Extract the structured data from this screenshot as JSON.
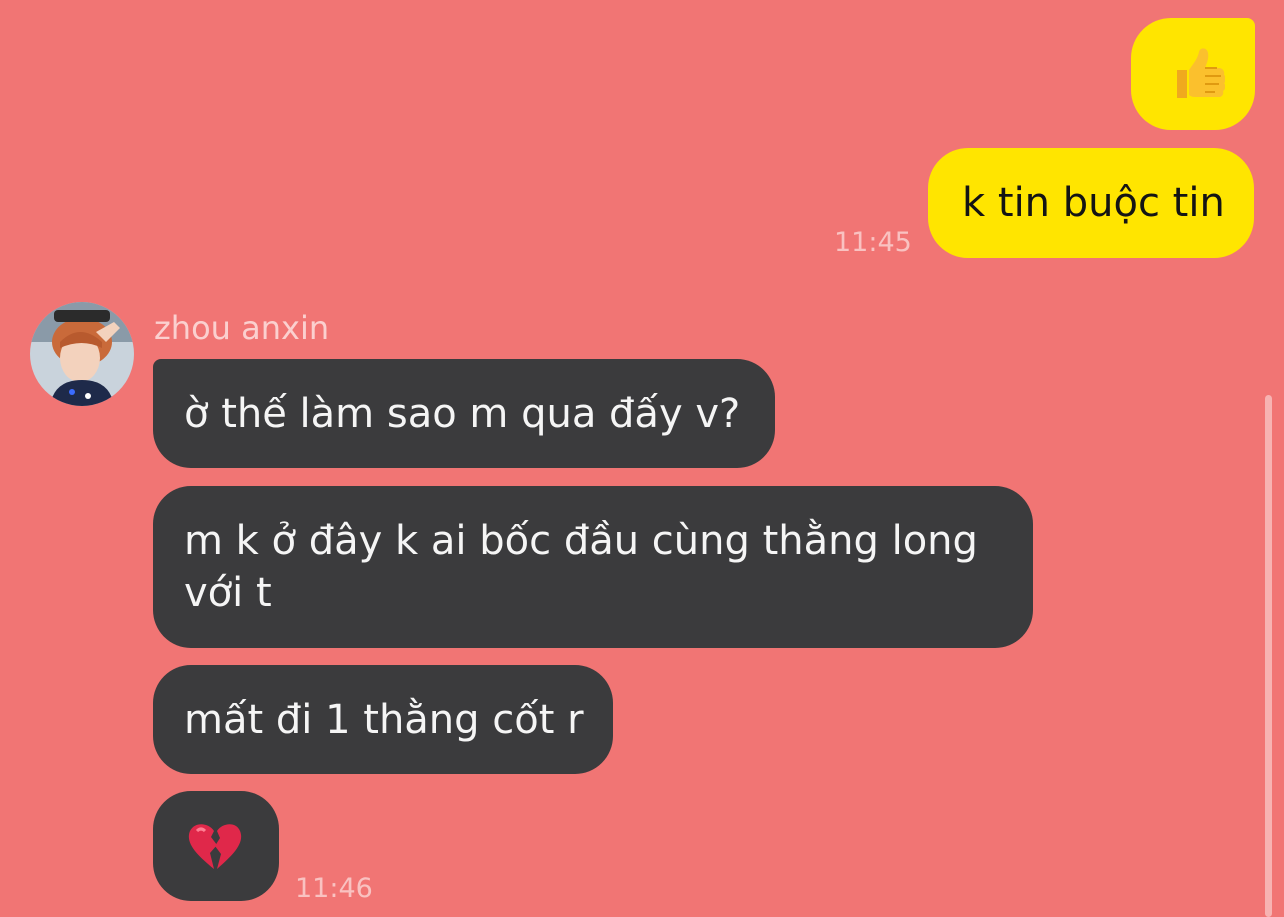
{
  "conversation": {
    "outgoing": [
      {
        "content": "👍",
        "emoji_name": "thumbs-up-icon"
      },
      {
        "content": "k tin buộc tin"
      }
    ],
    "outgoing_time": "11:45",
    "contact": {
      "name": "zhou anxin",
      "avatar_name": "avatar"
    },
    "incoming": [
      {
        "content": "ờ thế làm sao m qua đấy v?"
      },
      {
        "content": "m k ở đây k ai bốc đầu cùng thằng long với t"
      },
      {
        "content": "mất đi 1 thằng cốt r"
      },
      {
        "content": "💔",
        "emoji_name": "broken-heart-icon"
      }
    ],
    "incoming_time": "11:46"
  },
  "colors": {
    "background": "#f17574",
    "outgoing_bubble": "#ffe500",
    "incoming_bubble": "#3b3b3d",
    "timestamp": "#f9c2c1"
  }
}
